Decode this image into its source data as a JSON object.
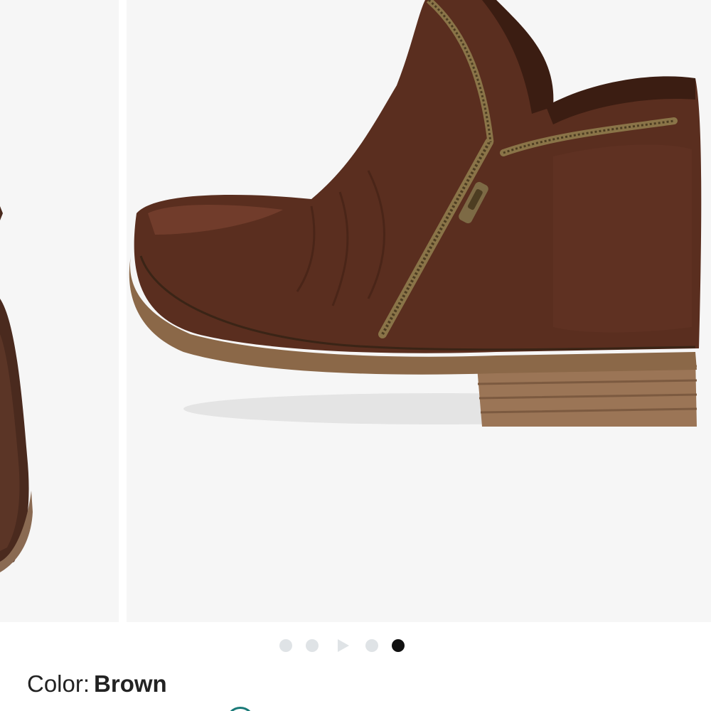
{
  "gallery": {
    "product_image_alt": "brown-ankle-boot-image",
    "slide_count": 5,
    "current_slide_index": 4,
    "dot_active_color": "#111111",
    "dot_inactive_color": "#dfe3e6"
  },
  "product": {
    "color_label": "Color:",
    "color_value": "Brown",
    "swatch_ring_color": "#1a7a78"
  }
}
